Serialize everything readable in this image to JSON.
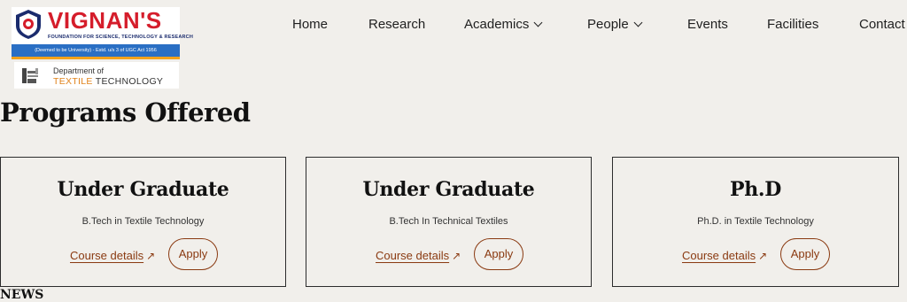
{
  "logo": {
    "brand": "VIGNAN'S",
    "tagline": "FOUNDATION FOR SCIENCE, TECHNOLOGY & RESEARCH",
    "band": "(Deemed to be University) - Estd. u/s 3 of UGC Act 1956",
    "dept_line1": "Department of",
    "dept_line2a": "TEXTILE",
    "dept_line2b": " TECHNOLOGY",
    "colors": {
      "brand": "#d51d2b",
      "band": "#2a6fc4",
      "stripe": "#f2a21c"
    }
  },
  "nav": {
    "items": [
      {
        "label": "Home"
      },
      {
        "label": "Research"
      },
      {
        "label": "Academics",
        "dropdown": true
      },
      {
        "label": "People",
        "dropdown": true
      },
      {
        "label": "Events"
      },
      {
        "label": "Facilities"
      },
      {
        "label": "Contact"
      }
    ]
  },
  "main": {
    "heading": "Programs Offered",
    "cards": [
      {
        "title": "Under Graduate",
        "subtitle": "B.Tech in Textile Technology",
        "details": "Course details",
        "apply": "Apply"
      },
      {
        "title": "Under Graduate",
        "subtitle": "B.Tech In Technical Textiles",
        "details": "Course details",
        "apply": "Apply"
      },
      {
        "title": "Ph.D",
        "subtitle": "Ph.D. in Textile Technology",
        "details": "Course details",
        "apply": "Apply"
      }
    ],
    "accent_color": "#8a3a11",
    "next_section": "NEWS"
  }
}
